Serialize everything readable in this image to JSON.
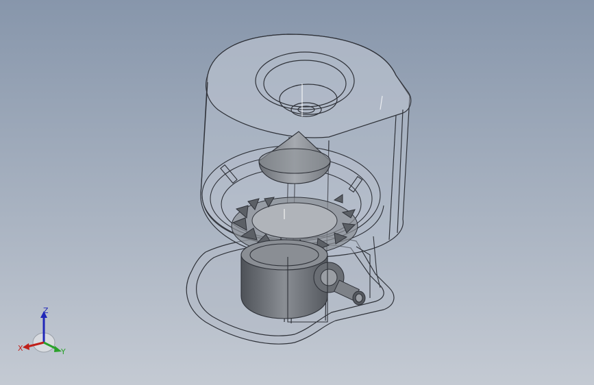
{
  "viewport": {
    "background_top": "#8796ab",
    "background_bottom": "#c4cad3"
  },
  "model": {
    "shell_fill": "#b7bfcc",
    "edge_color": "#2e3138",
    "metal_fill": "#6e7278",
    "metal_dark": "#4b4f55"
  },
  "triad": {
    "x_label": "X",
    "y_label": "Y",
    "z_label": "Z",
    "x_color": "#c0201a",
    "y_color": "#2aa12a",
    "z_color": "#2027b8"
  }
}
